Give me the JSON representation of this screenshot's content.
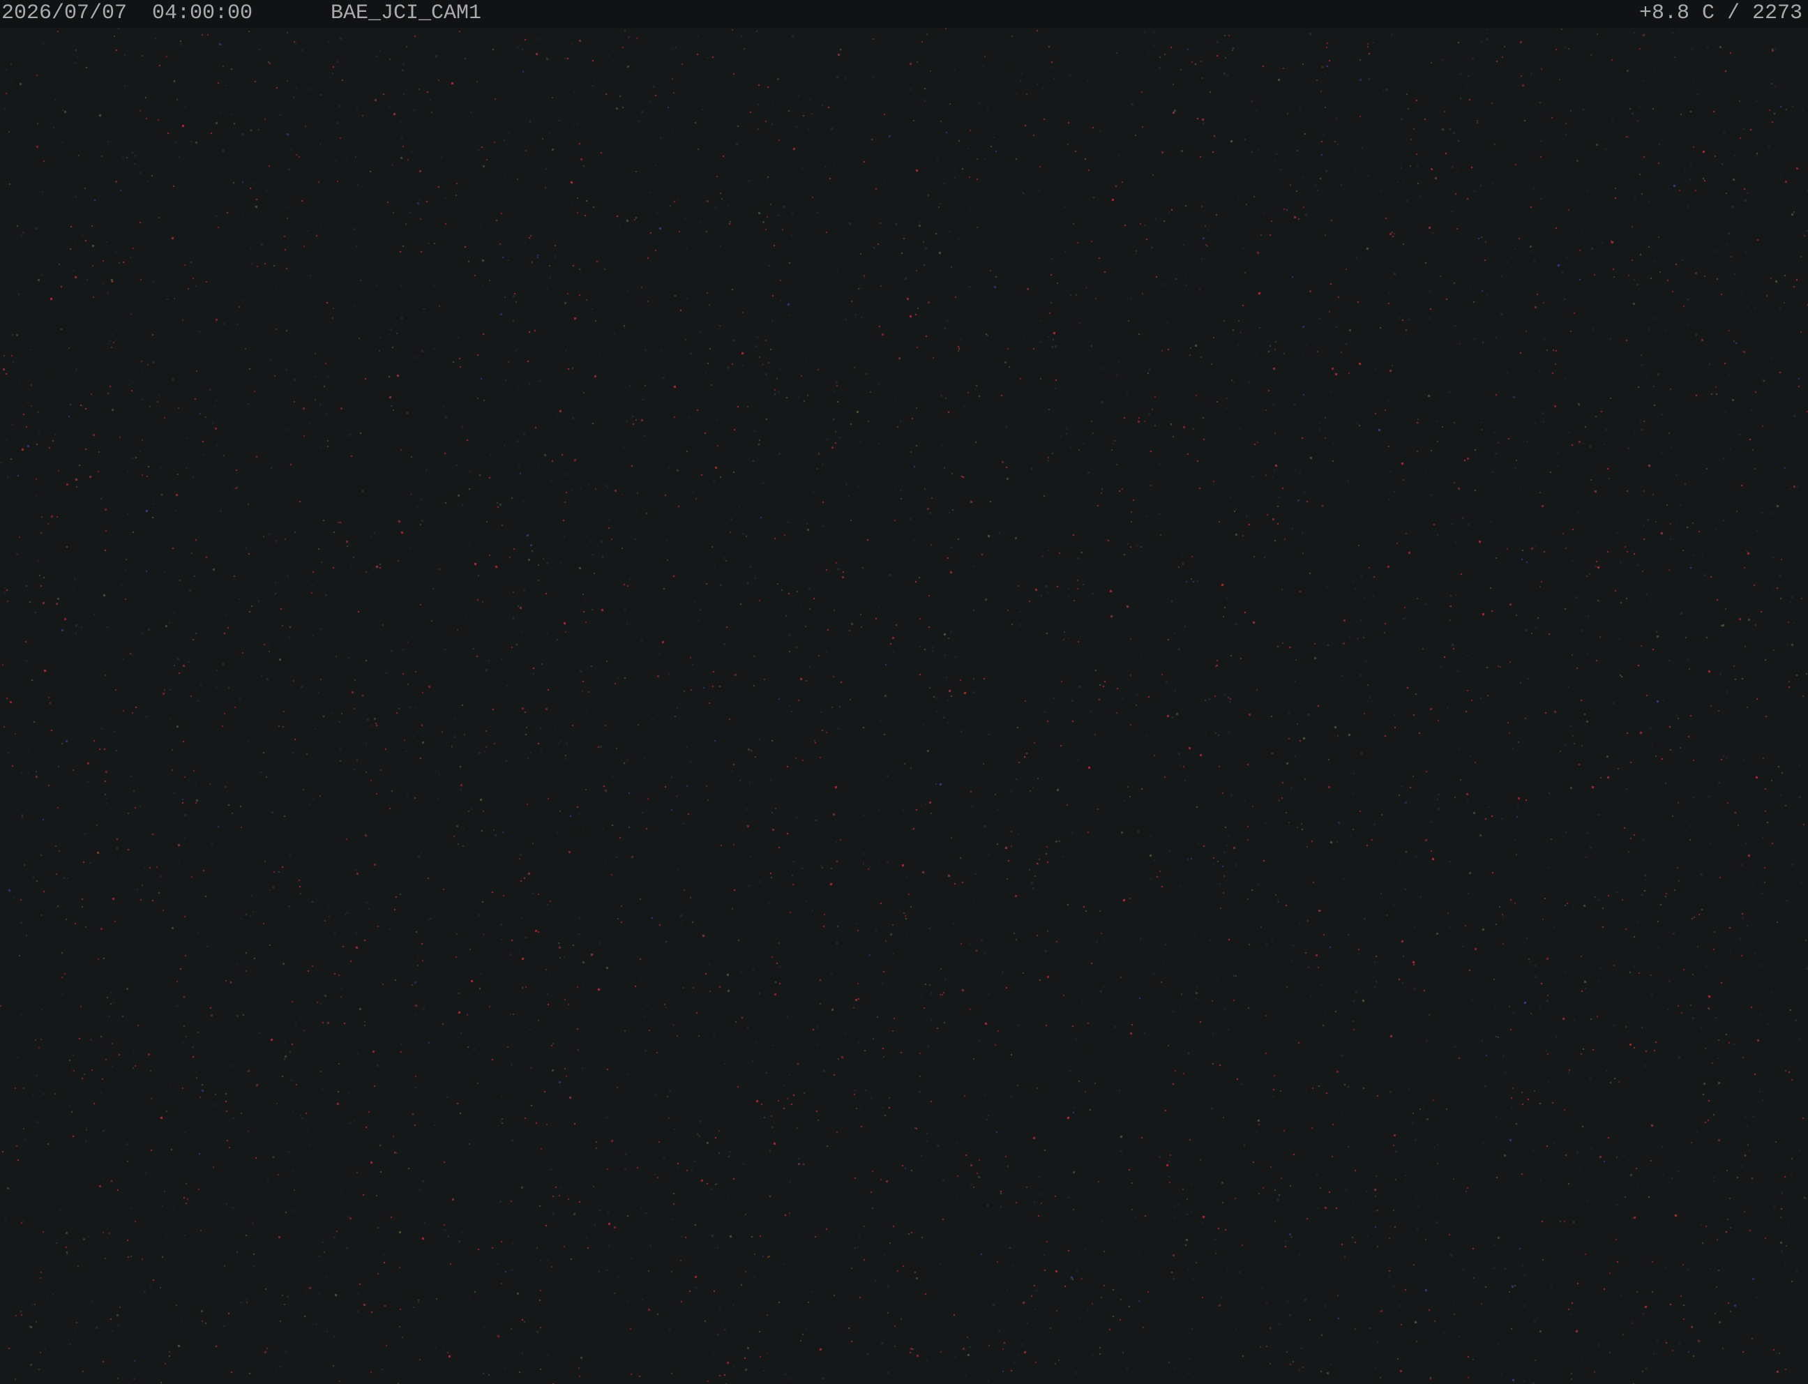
{
  "overlay": {
    "datetime": "2026/07/07  04:00:00",
    "camera_id": "BAE_JCI_CAM1",
    "readout": "+8.8 C / 2273"
  },
  "scene": {
    "description_type": "night-sky camera frame",
    "background_color": "#161718",
    "bar_color": "#111213",
    "text_color": "#a9abad",
    "speck_colors": [
      "#b0303a",
      "#8a3a40",
      "#3a3f8a",
      "#4a5a3c",
      "#2a2d30"
    ]
  }
}
